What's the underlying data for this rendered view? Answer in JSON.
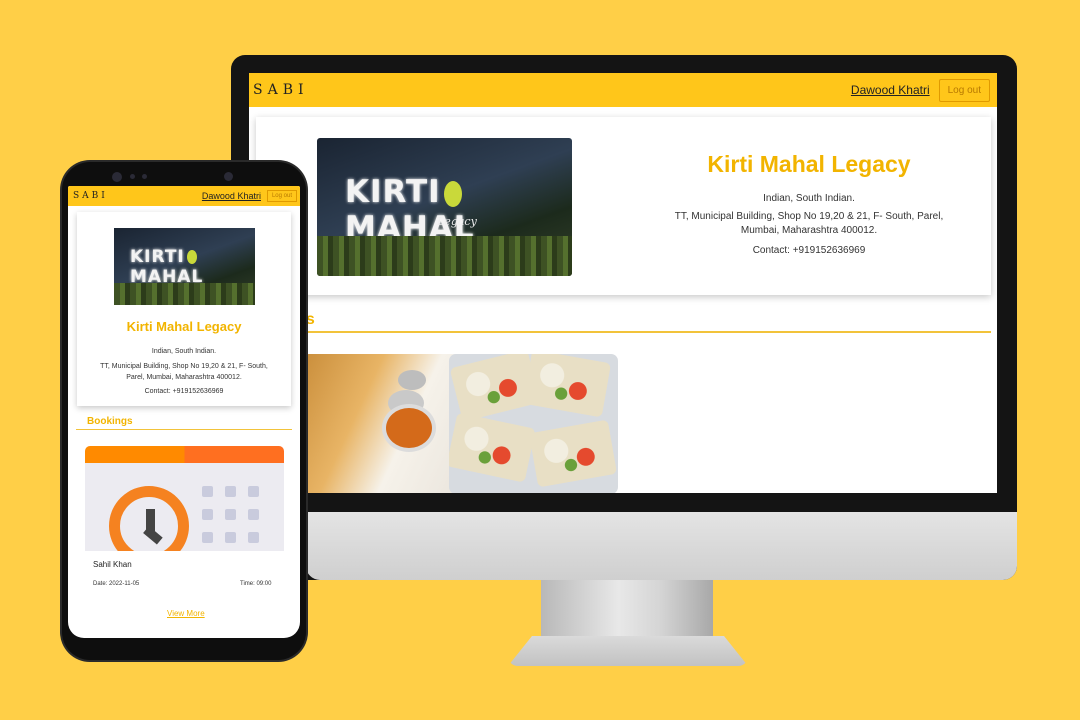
{
  "desktop": {
    "brand": "SABI",
    "user_name": "Dawood Khatri",
    "logout_label": "Log out",
    "restaurant": {
      "name": "Kirti Mahal Legacy",
      "cuisine": "Indian, South Indian.",
      "address": "TT, Municipal Building, Shop No 19,20 & 21, F- South, Parel, Mumbai, Maharashtra 400012.",
      "contact": "Contact: +919152636969",
      "sign_word1": "KIRTI",
      "sign_word2": "MAHAL",
      "sign_sub": "Legacy"
    },
    "section_partial": "es"
  },
  "mobile": {
    "brand": "SABI",
    "user_name": "Dawood Khatri",
    "logout_label": "Log out",
    "restaurant": {
      "name": "Kirti Mahal Legacy",
      "cuisine": "Indian, South Indian.",
      "address_line1": "TT, Municipal Building, Shop No 19,20 & 21, F- South,",
      "address_line2": "Parel, Mumbai, Maharashtra 400012.",
      "contact": "Contact: +919152636969",
      "sign_word1": "KIRTI",
      "sign_word2": "MAHAL"
    },
    "bookings_title": "Bookings",
    "booking": {
      "name": "Sahil Khan",
      "date": "Date: 2022-11-05",
      "time": "Time: 09:00"
    },
    "view_more": "View More"
  },
  "colors": {
    "background": "#FFCF47",
    "navbar": "#FFC61A",
    "accent": "#F2B400"
  }
}
